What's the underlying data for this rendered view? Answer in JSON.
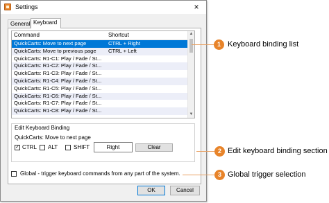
{
  "window": {
    "title": "Settings",
    "close_glyph": "×"
  },
  "tabs": [
    {
      "label": "General"
    },
    {
      "label": "Keyboard"
    }
  ],
  "list": {
    "headers": {
      "command": "Command",
      "shortcut": "Shortcut"
    },
    "rows": [
      {
        "command": "QuickCarts: Move to next page",
        "shortcut": "CTRL + Right"
      },
      {
        "command": "QuickCarts: Move to previous page",
        "shortcut": "CTRL + Left"
      },
      {
        "command": "QuickCarts: R1-C1: Play / Fade / St...",
        "shortcut": ""
      },
      {
        "command": "QuickCarts: R1-C2: Play / Fade / St...",
        "shortcut": ""
      },
      {
        "command": "QuickCarts: R1-C3: Play / Fade / St...",
        "shortcut": ""
      },
      {
        "command": "QuickCarts: R1-C4: Play / Fade / St...",
        "shortcut": ""
      },
      {
        "command": "QuickCarts: R1-C5: Play / Fade / St...",
        "shortcut": ""
      },
      {
        "command": "QuickCarts: R1-C6: Play / Fade / St...",
        "shortcut": ""
      },
      {
        "command": "QuickCarts: R1-C7: Play / Fade / St...",
        "shortcut": ""
      },
      {
        "command": "QuickCarts: R1-C8: Play / Fade / St...",
        "shortcut": ""
      }
    ]
  },
  "edit": {
    "group_title": "Edit Keyboard Binding",
    "current_command": "QuickCarts: Move to next page",
    "ctrl": {
      "label": "CTRL",
      "checked": true,
      "mark": "✓"
    },
    "alt": {
      "label": "ALT",
      "checked": false
    },
    "shift": {
      "label": "SHIFT",
      "checked": false
    },
    "key_value": "Right",
    "clear_label": "Clear"
  },
  "global": {
    "label": "Global - trigger keyboard commands from any part of the system.",
    "checked": false
  },
  "buttons": {
    "ok": "OK",
    "cancel": "Cancel"
  },
  "callouts": [
    {
      "number": "1",
      "text": "Keyboard binding list"
    },
    {
      "number": "2",
      "text": "Edit keyboard binding section"
    },
    {
      "number": "3",
      "text": "Global trigger selection"
    }
  ],
  "colors": {
    "accent": "#e8842a",
    "selection": "#0078d7",
    "alt_row": "#eceef8"
  }
}
